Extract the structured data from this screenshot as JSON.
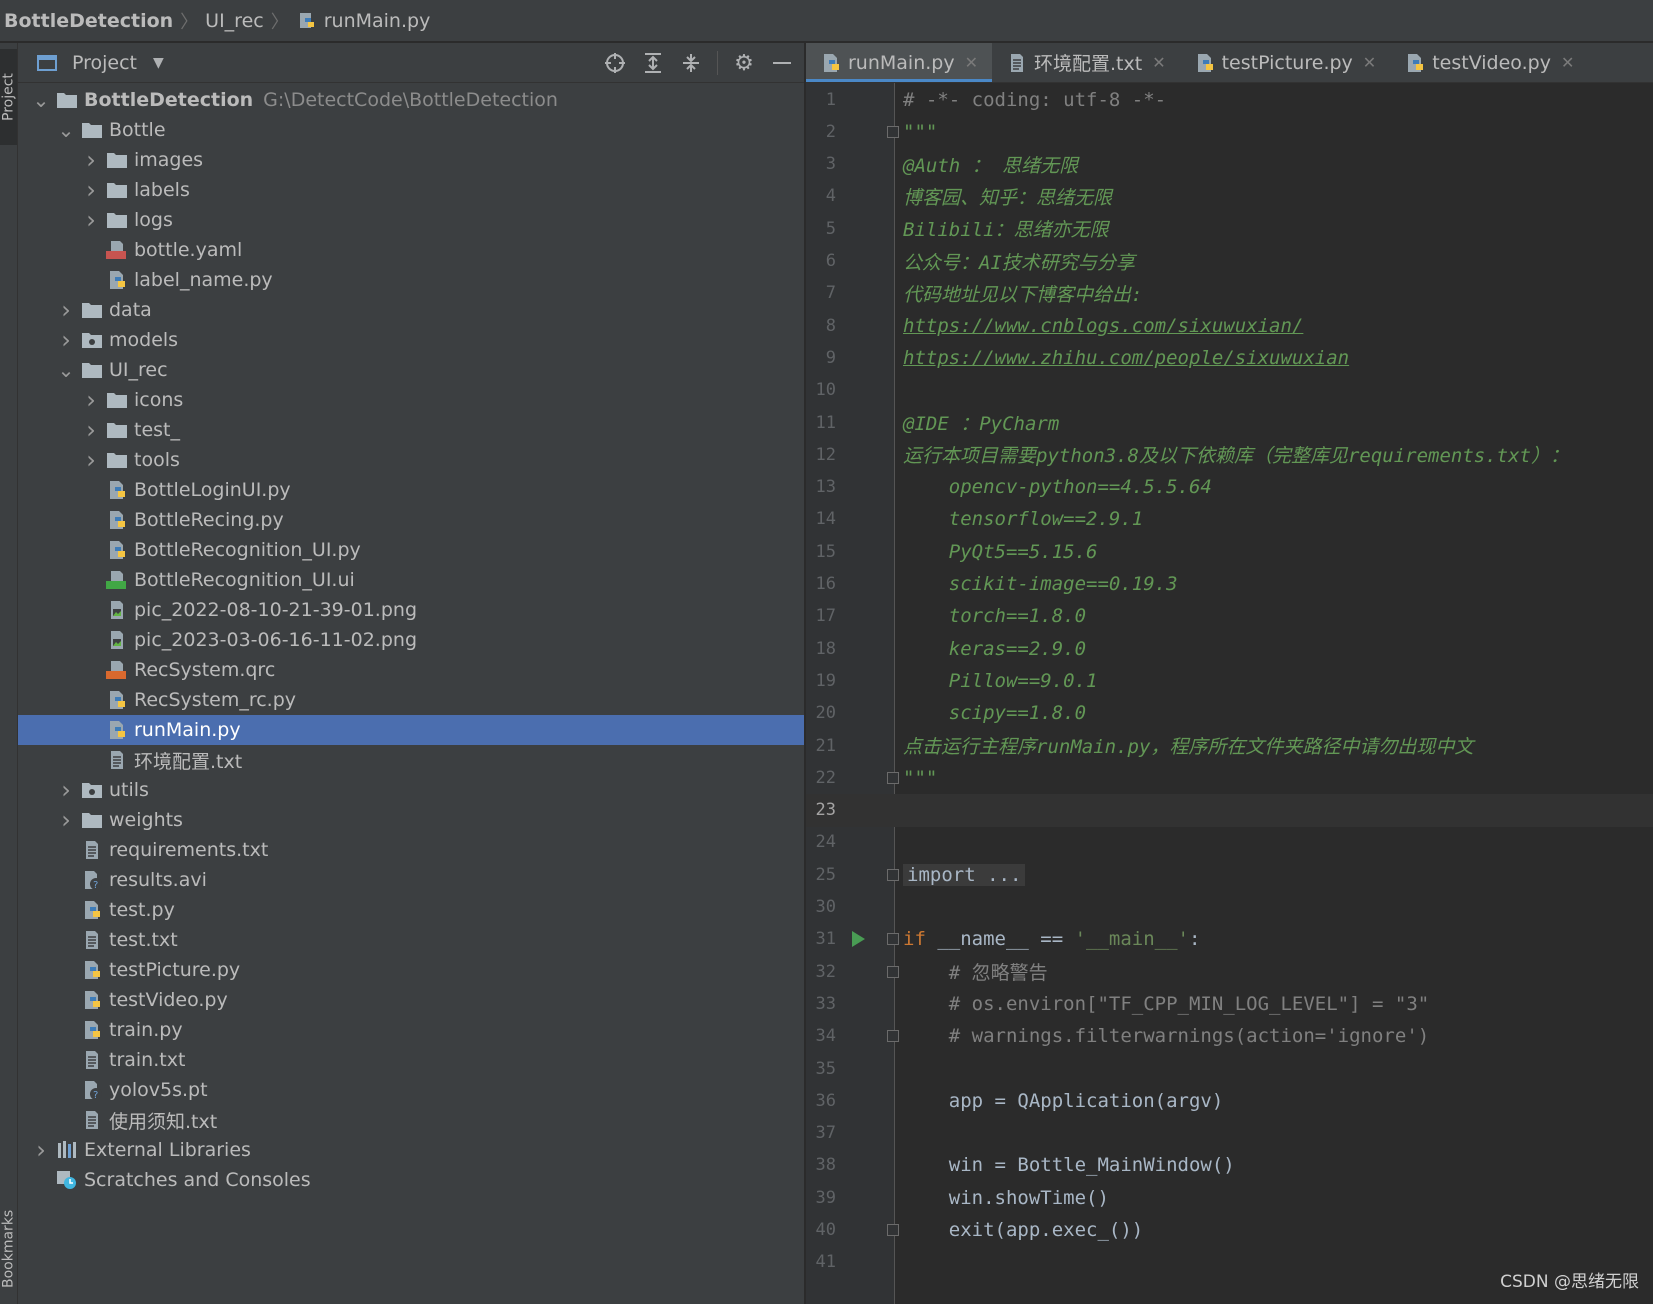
{
  "breadcrumb": {
    "project": "BottleDetection",
    "folder": "UI_rec",
    "file": "runMain.py"
  },
  "side_tabs": {
    "project": "Project",
    "bookmarks": "Bookmarks"
  },
  "project_panel": {
    "title": "Project",
    "tree": [
      {
        "label": "BottleDetection",
        "hint": "G:\\DetectCode\\BottleDetection",
        "depth": 0,
        "arrow": "down",
        "icon": "folder-icon",
        "bold": true
      },
      {
        "label": "Bottle",
        "depth": 1,
        "arrow": "down",
        "icon": "folder-icon"
      },
      {
        "label": "images",
        "depth": 2,
        "arrow": "right",
        "icon": "folder-icon"
      },
      {
        "label": "labels",
        "depth": 2,
        "arrow": "right",
        "icon": "folder-icon"
      },
      {
        "label": "logs",
        "depth": 2,
        "arrow": "right",
        "icon": "folder-icon"
      },
      {
        "label": "bottle.yaml",
        "depth": 2,
        "arrow": "",
        "icon": "yaml-file-icon"
      },
      {
        "label": "label_name.py",
        "depth": 2,
        "arrow": "",
        "icon": "python-file-icon"
      },
      {
        "label": "data",
        "depth": 1,
        "arrow": "right",
        "icon": "folder-icon"
      },
      {
        "label": "models",
        "depth": 1,
        "arrow": "right",
        "icon": "package-folder-icon"
      },
      {
        "label": "UI_rec",
        "depth": 1,
        "arrow": "down",
        "icon": "folder-icon"
      },
      {
        "label": "icons",
        "depth": 2,
        "arrow": "right",
        "icon": "folder-icon"
      },
      {
        "label": "test_",
        "depth": 2,
        "arrow": "right",
        "icon": "folder-icon"
      },
      {
        "label": "tools",
        "depth": 2,
        "arrow": "right",
        "icon": "folder-icon"
      },
      {
        "label": "BottleLoginUI.py",
        "depth": 2,
        "arrow": "",
        "icon": "python-file-icon"
      },
      {
        "label": "BottleRecing.py",
        "depth": 2,
        "arrow": "",
        "icon": "python-file-icon"
      },
      {
        "label": "BottleRecognition_UI.py",
        "depth": 2,
        "arrow": "",
        "icon": "python-file-icon"
      },
      {
        "label": "BottleRecognition_UI.ui",
        "depth": 2,
        "arrow": "",
        "icon": "qt-ui-file-icon"
      },
      {
        "label": "pic_2022-08-10-21-39-01.png",
        "depth": 2,
        "arrow": "",
        "icon": "image-file-icon"
      },
      {
        "label": "pic_2023-03-06-16-11-02.png",
        "depth": 2,
        "arrow": "",
        "icon": "image-file-icon"
      },
      {
        "label": "RecSystem.qrc",
        "depth": 2,
        "arrow": "",
        "icon": "qrc-file-icon"
      },
      {
        "label": "RecSystem_rc.py",
        "depth": 2,
        "arrow": "",
        "icon": "python-file-icon"
      },
      {
        "label": "runMain.py",
        "depth": 2,
        "arrow": "",
        "icon": "python-file-icon",
        "selected": true
      },
      {
        "label": "环境配置.txt",
        "depth": 2,
        "arrow": "",
        "icon": "text-file-icon"
      },
      {
        "label": "utils",
        "depth": 1,
        "arrow": "right",
        "icon": "package-folder-icon"
      },
      {
        "label": "weights",
        "depth": 1,
        "arrow": "right",
        "icon": "folder-icon"
      },
      {
        "label": "requirements.txt",
        "depth": 1,
        "arrow": "",
        "icon": "text-file-icon"
      },
      {
        "label": "results.avi",
        "depth": 1,
        "arrow": "",
        "icon": "unknown-file-icon"
      },
      {
        "label": "test.py",
        "depth": 1,
        "arrow": "",
        "icon": "python-file-icon"
      },
      {
        "label": "test.txt",
        "depth": 1,
        "arrow": "",
        "icon": "text-file-icon"
      },
      {
        "label": "testPicture.py",
        "depth": 1,
        "arrow": "",
        "icon": "python-file-icon"
      },
      {
        "label": "testVideo.py",
        "depth": 1,
        "arrow": "",
        "icon": "python-file-icon"
      },
      {
        "label": "train.py",
        "depth": 1,
        "arrow": "",
        "icon": "python-file-icon"
      },
      {
        "label": "train.txt",
        "depth": 1,
        "arrow": "",
        "icon": "text-file-icon"
      },
      {
        "label": "yolov5s.pt",
        "depth": 1,
        "arrow": "",
        "icon": "unknown-file-icon"
      },
      {
        "label": "使用须知.txt",
        "depth": 1,
        "arrow": "",
        "icon": "text-file-icon"
      },
      {
        "label": "External Libraries",
        "depth": 0,
        "arrow": "right",
        "icon": "libraries-icon"
      },
      {
        "label": "Scratches and Consoles",
        "depth": 0,
        "arrow": "",
        "icon": "scratches-icon"
      }
    ]
  },
  "editor": {
    "tabs": [
      {
        "label": "runMain.py",
        "icon": "python-file-icon",
        "active": true
      },
      {
        "label": "环境配置.txt",
        "icon": "text-file-icon",
        "active": false
      },
      {
        "label": "testPicture.py",
        "icon": "python-file-icon",
        "active": false
      },
      {
        "label": "testVideo.py",
        "icon": "python-file-icon",
        "active": false
      }
    ],
    "current_line": 23,
    "lines": [
      {
        "n": "1",
        "segs": [
          {
            "t": "# -*- coding: utf-8 -*-",
            "c": "c-comment"
          }
        ]
      },
      {
        "n": "2",
        "fold": true,
        "segs": [
          {
            "t": "\"\"\"",
            "c": "c-doc"
          }
        ]
      },
      {
        "n": "3",
        "segs": [
          {
            "t": "@Auth ： 思绪无限",
            "c": "c-doc"
          }
        ]
      },
      {
        "n": "4",
        "segs": [
          {
            "t": "博客园、知乎：思绪无限",
            "c": "c-doc"
          }
        ]
      },
      {
        "n": "5",
        "segs": [
          {
            "t": "Bilibili：思绪亦无限",
            "c": "c-doc"
          }
        ]
      },
      {
        "n": "6",
        "segs": [
          {
            "t": "公众号：AI技术研究与分享",
            "c": "c-doc"
          }
        ]
      },
      {
        "n": "7",
        "segs": [
          {
            "t": "代码地址见以下博客中给出:",
            "c": "c-doc"
          }
        ]
      },
      {
        "n": "8",
        "segs": [
          {
            "t": "https://www.cnblogs.com/sixuwuxian/",
            "c": "c-link"
          }
        ]
      },
      {
        "n": "9",
        "segs": [
          {
            "t": "https://www.zhihu.com/people/sixuwuxian",
            "c": "c-link"
          }
        ]
      },
      {
        "n": "10",
        "segs": []
      },
      {
        "n": "11",
        "segs": [
          {
            "t": "@IDE ：PyCharm",
            "c": "c-doc"
          }
        ]
      },
      {
        "n": "12",
        "segs": [
          {
            "t": "运行本项目需要python3.8及以下依赖库（完整库见requirements.txt）：",
            "c": "c-doc"
          }
        ]
      },
      {
        "n": "13",
        "segs": [
          {
            "t": "    opencv-python==4.5.5.64",
            "c": "c-doc"
          }
        ]
      },
      {
        "n": "14",
        "segs": [
          {
            "t": "    tensorflow==2.9.1",
            "c": "c-doc"
          }
        ]
      },
      {
        "n": "15",
        "segs": [
          {
            "t": "    PyQt5==5.15.6",
            "c": "c-doc"
          }
        ]
      },
      {
        "n": "16",
        "segs": [
          {
            "t": "    scikit-image==0.19.3",
            "c": "c-doc"
          }
        ]
      },
      {
        "n": "17",
        "segs": [
          {
            "t": "    torch==1.8.0",
            "c": "c-doc"
          }
        ]
      },
      {
        "n": "18",
        "segs": [
          {
            "t": "    keras==2.9.0",
            "c": "c-doc"
          }
        ]
      },
      {
        "n": "19",
        "segs": [
          {
            "t": "    Pillow==9.0.1",
            "c": "c-doc"
          }
        ]
      },
      {
        "n": "20",
        "segs": [
          {
            "t": "    scipy==1.8.0",
            "c": "c-doc"
          }
        ]
      },
      {
        "n": "21",
        "segs": [
          {
            "t": "点击运行主程序runMain.py，程序所在文件夹路径中请勿出现中文",
            "c": "c-doc"
          }
        ]
      },
      {
        "n": "22",
        "fold": true,
        "segs": [
          {
            "t": "\"\"\"",
            "c": "c-doc"
          }
        ]
      },
      {
        "n": "23",
        "segs": []
      },
      {
        "n": "24",
        "segs": []
      },
      {
        "n": "25",
        "fold": true,
        "segs": [
          {
            "t": "import ...",
            "c": "c-fold-box"
          }
        ]
      },
      {
        "n": "30",
        "segs": []
      },
      {
        "n": "31",
        "fold": true,
        "run": true,
        "segs": [
          {
            "t": "if",
            "c": "c-kw"
          },
          {
            "t": " __name__ == ",
            "c": "c-plain"
          },
          {
            "t": "'__main__'",
            "c": "c-str"
          },
          {
            "t": ":",
            "c": "c-plain"
          }
        ]
      },
      {
        "n": "32",
        "fold": true,
        "segs": [
          {
            "t": "    # 忽略警告",
            "c": "c-comment"
          }
        ]
      },
      {
        "n": "33",
        "segs": [
          {
            "t": "    # os.environ[\"TF_CPP_MIN_LOG_LEVEL\"] = \"3\"",
            "c": "c-comment"
          }
        ]
      },
      {
        "n": "34",
        "fold": true,
        "segs": [
          {
            "t": "    # warnings.filterwarnings(action='ignore')",
            "c": "c-comment"
          }
        ]
      },
      {
        "n": "35",
        "segs": []
      },
      {
        "n": "36",
        "segs": [
          {
            "t": "    app = QApplication(argv)",
            "c": "c-plain"
          }
        ]
      },
      {
        "n": "37",
        "segs": []
      },
      {
        "n": "38",
        "segs": [
          {
            "t": "    win = Bottle_MainWindow()",
            "c": "c-plain"
          }
        ]
      },
      {
        "n": "39",
        "segs": [
          {
            "t": "    win.showTime()",
            "c": "c-plain"
          }
        ]
      },
      {
        "n": "40",
        "fold": true,
        "segs": [
          {
            "t": "    exit(app.exec_())",
            "c": "c-plain"
          }
        ]
      },
      {
        "n": "41",
        "segs": []
      }
    ]
  },
  "watermark": "CSDN @思绪无限",
  "colors": {
    "selection": "#4b6eaf",
    "docstring": "#629755",
    "keyword": "#cc7832",
    "string": "#6a8759",
    "comment": "#808080"
  }
}
